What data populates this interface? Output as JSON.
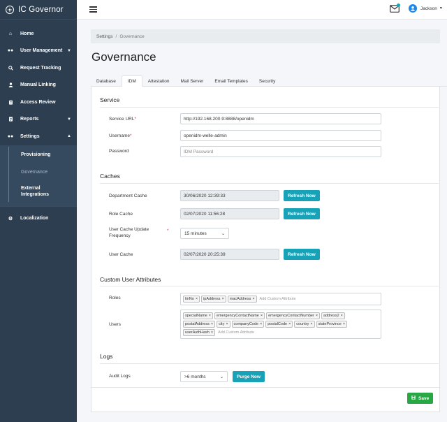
{
  "app": {
    "name": "IC Governor"
  },
  "sidebar": {
    "items": [
      {
        "label": "Home",
        "icon": "home-icon"
      },
      {
        "label": "User Management",
        "icon": "users-icon",
        "caret": true
      },
      {
        "label": "Request Tracking",
        "icon": "search-icon"
      },
      {
        "label": "Manual Linking",
        "icon": "user-icon"
      },
      {
        "label": "Access Review",
        "icon": "clipboard-icon"
      },
      {
        "label": "Reports",
        "icon": "report-icon",
        "caret": true
      },
      {
        "label": "Settings",
        "icon": "users-cog-icon",
        "caret": true
      }
    ],
    "settings_sub": [
      {
        "label": "Provisioning"
      },
      {
        "label": "Governance",
        "active": true
      },
      {
        "label": "External Integrations"
      }
    ],
    "bottom": {
      "label": "Localization",
      "icon": "gear-icon"
    }
  },
  "topbar": {
    "user_name": "Jackson"
  },
  "breadcrumb": {
    "root": "Settings",
    "sep": "/",
    "current": "Governance"
  },
  "page": {
    "title": "Governance"
  },
  "tabs": [
    {
      "label": "Database"
    },
    {
      "label": "IDM",
      "active": true
    },
    {
      "label": "Attestation"
    },
    {
      "label": "Mail Server"
    },
    {
      "label": "Email Templates"
    },
    {
      "label": "Security"
    }
  ],
  "service": {
    "title": "Service",
    "url_label": "Service URL",
    "url_value": "http://192.168.200.9:8888/openidm",
    "username_label": "Username",
    "username_value": "openidm-welle-admin",
    "password_label": "Password",
    "password_placeholder": "IDM Password"
  },
  "caches": {
    "title": "Caches",
    "department_label": "Department Cache",
    "department_value": "30/06/2020 12:39:33",
    "role_label": "Role Cache",
    "role_value": "02/07/2020 11:56:28",
    "freq_label": "User Cache Update Frequency",
    "freq_value": "15 minutes",
    "user_label": "User Cache",
    "user_value": "02/07/2020 20:25:39",
    "refresh_label": "Refresh Now"
  },
  "attributes": {
    "title": "Custom User Attributes",
    "roles_label": "Roles",
    "roles_tags": [
      "tinNo",
      "ipAddress",
      "macAddress"
    ],
    "users_label": "Users",
    "users_tags": [
      "specialName",
      "emergencyContactName",
      "emergencyContactNumber",
      "address2",
      "postalAddress",
      "city",
      "companyCode",
      "postalCode",
      "country",
      "stateProvince",
      "userAuthHash"
    ],
    "add_placeholder": "Add Custom Attribute"
  },
  "logs": {
    "title": "Logs",
    "audit_label": "Audit Logs",
    "audit_value": ">6 months",
    "purge_label": "Purge Now"
  },
  "footer": {
    "save_label": "Save"
  },
  "colors": {
    "sidebar": "#2c3e50",
    "info": "#17a2b8",
    "success": "#28a745",
    "required": "#dc3545"
  }
}
